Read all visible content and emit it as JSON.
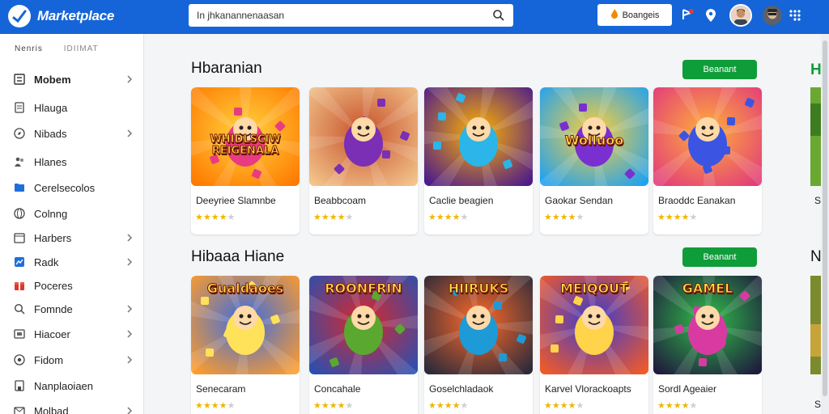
{
  "header": {
    "app_name": "Marketplace",
    "search_value": "In jhkanannenaasan",
    "promo_label": "Boangeis"
  },
  "sidebar": {
    "headings": [
      "Nenris",
      "IDIIMAT"
    ],
    "items": [
      {
        "label": "Mobem",
        "icon": "list-icon",
        "chevron": true,
        "active": true
      },
      {
        "label": "Hlauga",
        "icon": "document-icon",
        "chevron": false
      },
      {
        "label": "Nibads",
        "icon": "compass-icon",
        "chevron": true
      },
      {
        "label": "Hlanes",
        "icon": "people-icon",
        "chevron": false
      },
      {
        "label": "Cerelsecolos",
        "icon": "folder-icon",
        "chevron": false
      },
      {
        "label": "Colnng",
        "icon": "globe-icon",
        "chevron": false
      },
      {
        "label": "Harbers",
        "icon": "calendar-icon",
        "chevron": true
      },
      {
        "label": "Radk",
        "icon": "chart-icon",
        "chevron": true
      },
      {
        "label": "Poceres",
        "icon": "gift-icon",
        "chevron": false
      },
      {
        "label": "Fomnde",
        "icon": "search-icon",
        "chevron": true
      },
      {
        "label": "Hiacoer",
        "icon": "box-icon",
        "chevron": true
      },
      {
        "label": "Fidom",
        "icon": "target-icon",
        "chevron": true
      },
      {
        "label": "Nanplaoiaen",
        "icon": "store-icon",
        "chevron": false
      },
      {
        "label": "Molbad",
        "icon": "mail-icon",
        "chevron": true
      }
    ]
  },
  "sections": [
    {
      "title": "Hbaranian",
      "see_all": "Beanant",
      "cards": [
        {
          "title": "Deeyriee Slamnbe",
          "rating": 4,
          "thumb_text": "WHIDLSCIW REIGENALA"
        },
        {
          "title": "Beabbcoam",
          "rating": 4,
          "thumb_text": ""
        },
        {
          "title": "Caclie beagien",
          "rating": 4,
          "thumb_text": ""
        },
        {
          "title": "Gaokar Sendan",
          "rating": 4,
          "thumb_text": "Wolluoo"
        },
        {
          "title": "Braoddc Eanakan",
          "rating": 4,
          "thumb_text": ""
        }
      ],
      "peek_label": "S"
    },
    {
      "title": "Hibaaa Hiane",
      "see_all": "Beanant",
      "cards": [
        {
          "title": "Senecaram",
          "rating": 4,
          "thumb_text": "Gualdaoes"
        },
        {
          "title": "Concahale",
          "rating": 4,
          "thumb_text": "ROONFRIN"
        },
        {
          "title": "Goselchladaok",
          "rating": 4,
          "thumb_text": "HIIRUKS"
        },
        {
          "title": "Karvel Vlorackoapts",
          "rating": 4,
          "thumb_text": "MEIQOUT"
        },
        {
          "title": "Sordl Ageaier",
          "rating": 4,
          "thumb_text": "GAMEL"
        }
      ],
      "peek_label": "S"
    }
  ],
  "colors": {
    "topbar": "#1565d8",
    "accent_green": "#0f9d3a",
    "star": "#f2b600"
  }
}
